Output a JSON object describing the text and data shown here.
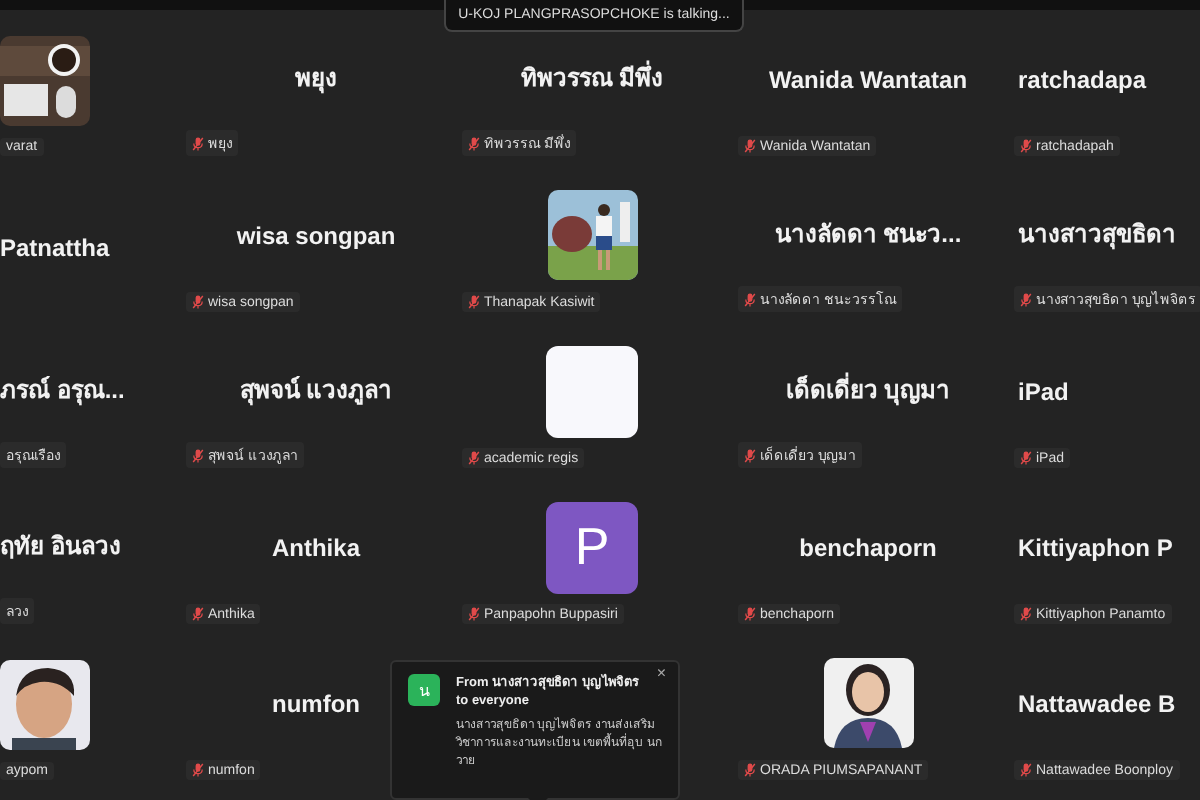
{
  "speaking_banner": "U-KOJ PLANGPRASOPCHOKE is talking...",
  "rows": [
    {
      "tiles": [
        {
          "label": "varat",
          "muted": false
        },
        {
          "kind": "name",
          "name": "พยุง",
          "label": "พยุง",
          "muted": true
        },
        {
          "kind": "name",
          "name": "ทิพวรรณ มีพึ่ง",
          "label": "ทิพวรรณ มีพึ่ง",
          "muted": true
        },
        {
          "kind": "name",
          "name": "Wanida Wantatan",
          "label": "Wanida Wantatan",
          "muted": true
        },
        {
          "kind": "name",
          "name": "ratchadapa",
          "label": "ratchadapah",
          "muted": true
        }
      ]
    },
    {
      "tiles": [
        {
          "kind": "name",
          "name": "Patnattha"
        },
        {
          "kind": "name",
          "name": "wisa songpan",
          "label": "wisa songpan",
          "muted": true
        },
        {
          "label": "Thanapak Kasiwit",
          "muted": true
        },
        {
          "kind": "name",
          "name": "นางลัดดา  ชนะว...",
          "label": "นางลัดดา  ชนะวรรโณ",
          "muted": true
        },
        {
          "kind": "name",
          "name": "นางสาวสุขธิดา",
          "label": "นางสาวสุขธิดา  บุญไพจิตร",
          "muted": true
        }
      ]
    },
    {
      "tiles": [
        {
          "kind": "name",
          "name": "ภรณ์ อรุณ...",
          "label": "อรุณเรือง",
          "muted": false
        },
        {
          "kind": "name",
          "name": "สุพจน์ แวงภูลา",
          "label": "สุพจน์ แวงภูลา",
          "muted": true
        },
        {
          "kind": "blank",
          "label": "academic regis",
          "muted": true
        },
        {
          "kind": "name",
          "name": "เด็ดเดี่ยว บุญมา",
          "label": "เด็ดเดี่ยว บุญมา",
          "muted": true
        },
        {
          "kind": "name",
          "name": "iPad",
          "label": "iPad",
          "muted": true
        }
      ]
    },
    {
      "tiles": [
        {
          "kind": "name",
          "name": "ฤทัย  อินลวง",
          "label": "ลวง",
          "muted": false
        },
        {
          "kind": "name",
          "name": "Anthika",
          "label": "Anthika",
          "muted": true
        },
        {
          "kind": "initial",
          "initial": "P",
          "color": "#7e57c2",
          "label": "Panpapohn Buppasiri",
          "muted": true
        },
        {
          "kind": "name",
          "name": "benchaporn",
          "label": "benchaporn",
          "muted": true
        },
        {
          "kind": "name",
          "name": "Kittiyaphon  P",
          "label": "Kittiyaphon Panamto",
          "muted": true
        }
      ]
    },
    {
      "tiles": [
        {
          "label": "aypom",
          "muted": false
        },
        {
          "kind": "name",
          "name": "numfon",
          "label": "numfon",
          "muted": true
        },
        {
          "kind": "chat",
          "avatar": "น",
          "from": "From นางสาวสุขธิดา  บุญไพจิตร to everyone",
          "message": "นางสาวสุขธิดา บุญไพจิตร งานส่งเสริมวิชาการและงานทะเบียน เขตพื้นที่อุบ นกวาย",
          "close": "×"
        },
        {
          "label": "ORADA PIUMSAPANANT",
          "muted": true
        },
        {
          "kind": "name",
          "name": "Nattawadee  B",
          "label": "Nattawadee Boonploy",
          "muted": true
        }
      ]
    }
  ]
}
